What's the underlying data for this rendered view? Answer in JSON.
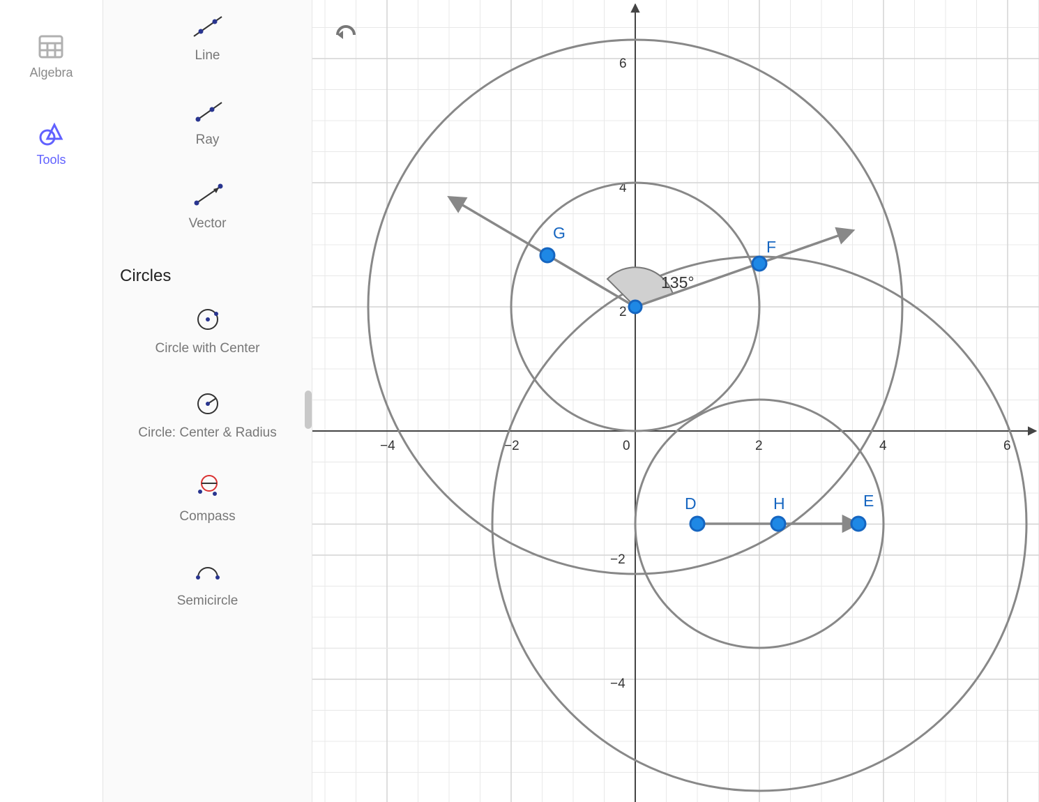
{
  "leftRail": {
    "algebra": "Algebra",
    "tools": "Tools"
  },
  "toolPanel": {
    "line": "Line",
    "ray": "Ray",
    "vector": "Vector",
    "circlesHeader": "Circles",
    "circleWithCenter": "Circle with Center",
    "circleCenterRadius": "Circle: Center & Radius",
    "compass": "Compass",
    "semicircle": "Semicircle"
  },
  "canvas": {
    "angleLabel": "135°",
    "points": {
      "G": "G",
      "F": "F",
      "D": "D",
      "H": "H",
      "E": "E"
    },
    "axisTicks": {
      "x": [
        "−4",
        "−2",
        "0",
        "2",
        "4",
        "6"
      ],
      "y": [
        "6",
        "4",
        "2",
        "−2",
        "−4"
      ]
    }
  },
  "chart_data": {
    "type": "coordinate-geometry",
    "title": "",
    "xlabel": "",
    "ylabel": "",
    "xlim": [
      -5,
      6.5
    ],
    "ylim": [
      -5.5,
      6.5
    ],
    "grid": true,
    "points": [
      {
        "name": "G",
        "x": -1.414,
        "y": 3.414
      },
      {
        "name": "F",
        "x": 2,
        "y": 2.7
      },
      {
        "name": "D",
        "x": 1,
        "y": -1.5
      },
      {
        "name": "H",
        "x": 2.3,
        "y": -1.5
      },
      {
        "name": "E",
        "x": 3.6,
        "y": -1.5
      },
      {
        "name": "center1",
        "x": 0,
        "y": 2
      },
      {
        "name": "center2",
        "x": 2,
        "y": -1.5
      }
    ],
    "angle": {
      "vertex": [
        0,
        2
      ],
      "ray1_to": [
        2,
        2.7
      ],
      "ray2_to": [
        -1.414,
        3.414
      ],
      "value": 135
    },
    "vector": {
      "from": [
        1,
        -1.5
      ],
      "to": [
        3.6,
        -1.5
      ]
    },
    "circles": [
      {
        "cx": 0,
        "cy": 2,
        "r": 2
      },
      {
        "cx": 0,
        "cy": 2,
        "r": 4.3
      },
      {
        "cx": 2,
        "cy": -1.5,
        "r": 2
      },
      {
        "cx": 2,
        "cy": -1.5,
        "r": 4.3
      }
    ]
  }
}
